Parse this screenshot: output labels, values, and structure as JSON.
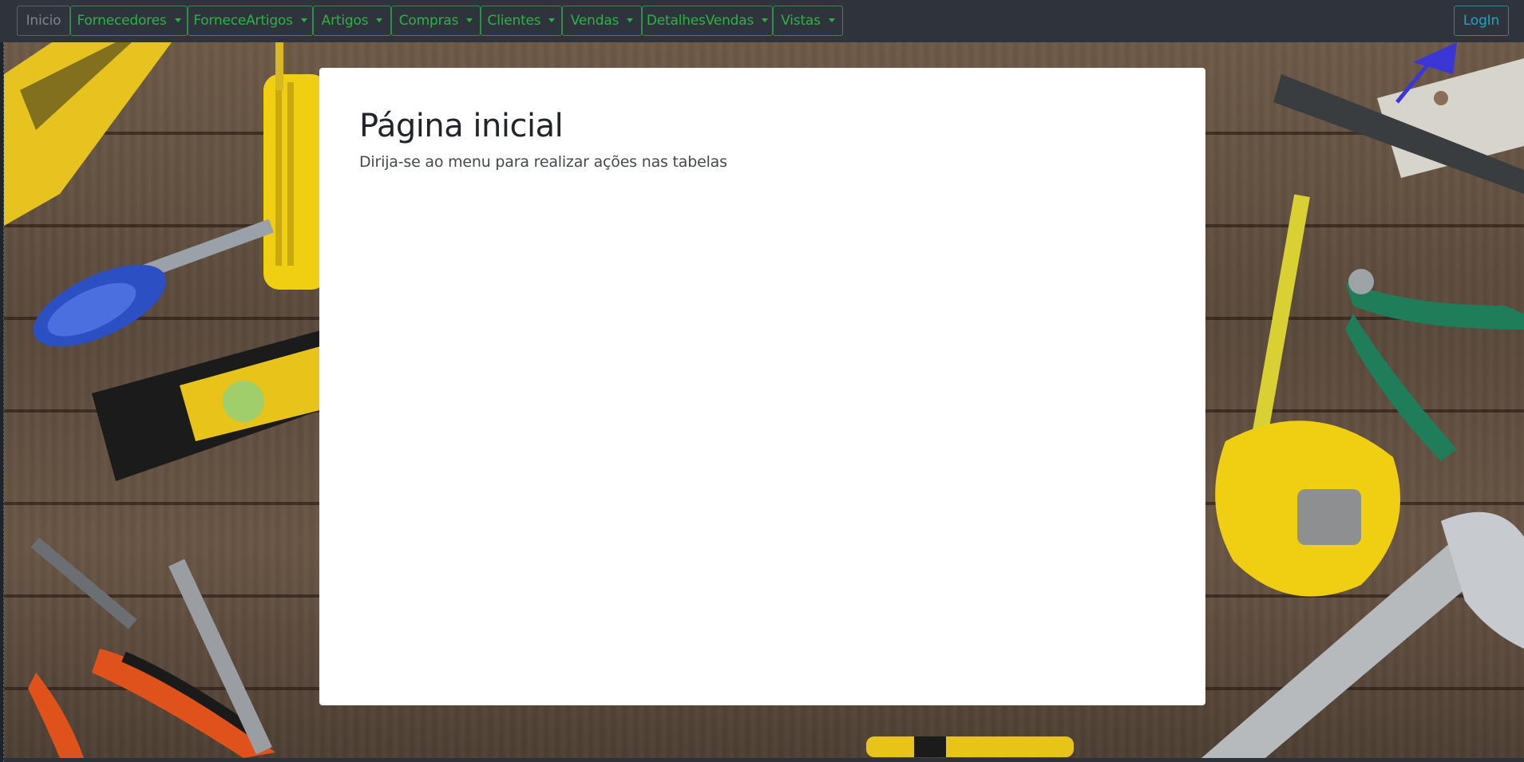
{
  "navbar": {
    "home_label": "Inicio",
    "menus": [
      {
        "label": "Fornecedores"
      },
      {
        "label": "ForneceArtigos"
      },
      {
        "label": "Artigos"
      },
      {
        "label": "Compras"
      },
      {
        "label": "Clientes"
      },
      {
        "label": "Vendas"
      },
      {
        "label": "DetalhesVendas"
      },
      {
        "label": "Vistas"
      }
    ],
    "login_label": "LogIn"
  },
  "main": {
    "title": "Página inicial",
    "subtitle": "Dirija-se ao menu para realizar ações nas tabelas"
  },
  "colors": {
    "nav_bg": "#2f343c",
    "menu_green": "#28b445",
    "login_teal": "#1aa7c6",
    "annotation_arrow": "#3a37d6"
  },
  "icons": {
    "dropdown": "caret-down-icon",
    "annotation": "arrow-pointer-icon"
  }
}
